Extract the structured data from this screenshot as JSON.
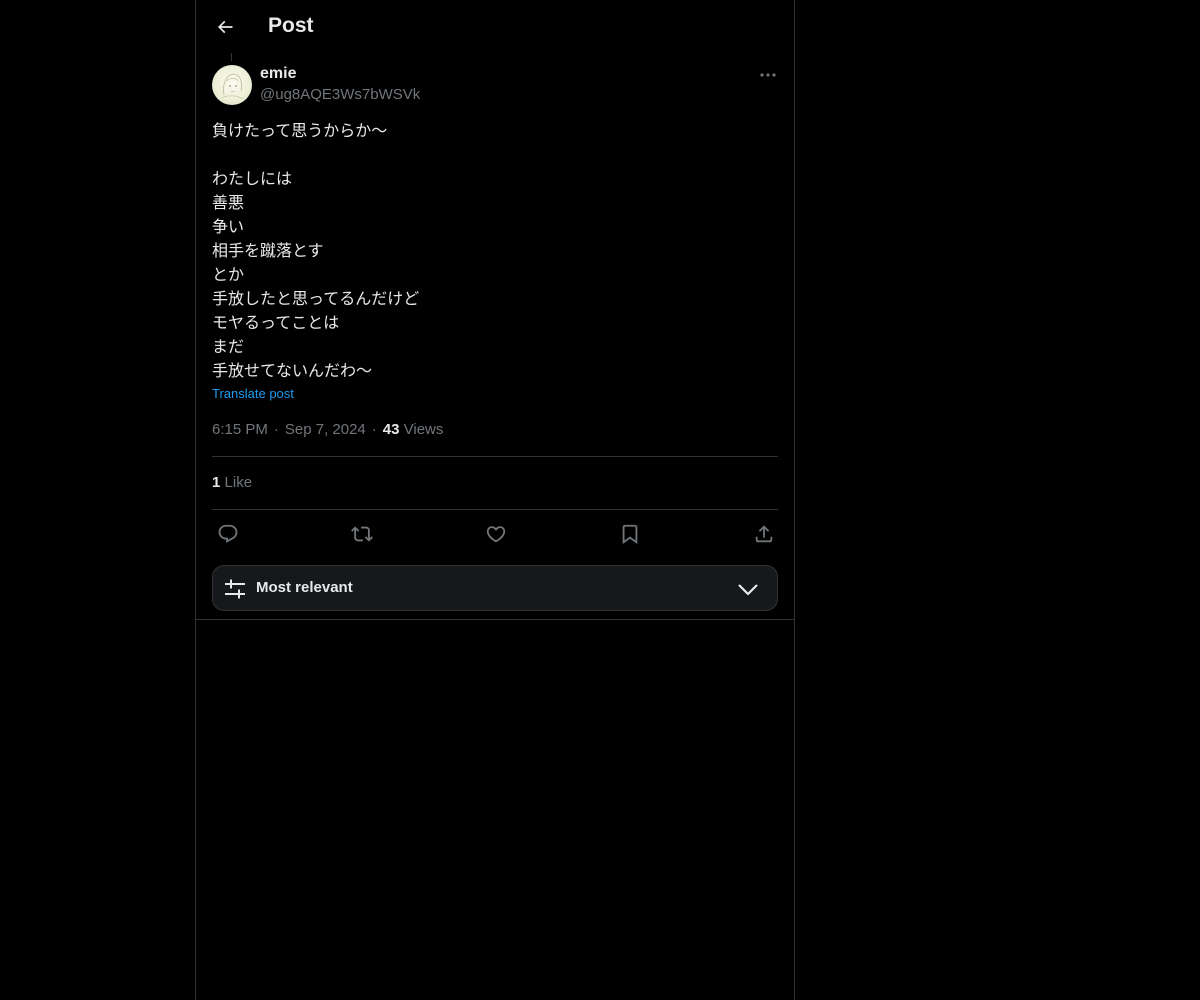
{
  "header": {
    "title": "Post",
    "back_icon": "arrow-left-icon"
  },
  "author": {
    "display_name": "emie",
    "handle": "@ug8AQE3Ws7bWSVk"
  },
  "post": {
    "lines": [
      "負けたって思うからか〜",
      "",
      "わたしには",
      "善悪",
      "争い",
      "相手を蹴落とす",
      "とか",
      "手放したと思ってるんだけど",
      "モヤるってことは",
      "まだ",
      "手放せてないんだわ〜"
    ],
    "translate_label": "Translate post",
    "time": "6:15 PM",
    "separator": "·",
    "date": "Sep 7, 2024",
    "views_count": "43",
    "views_label": "Views"
  },
  "engagement": {
    "likes_count": "1",
    "likes_label": "Like"
  },
  "actions": {
    "reply_icon": "reply-icon",
    "repost_icon": "repost-icon",
    "like_icon": "heart-icon",
    "bookmark_icon": "bookmark-icon",
    "share_icon": "share-icon"
  },
  "replies_sort": {
    "label": "Most relevant"
  },
  "colors": {
    "background": "#000000",
    "text": "#e7e9ea",
    "secondary_text": "#71767b",
    "link": "#1d9bf0",
    "border": "#2f3336"
  }
}
